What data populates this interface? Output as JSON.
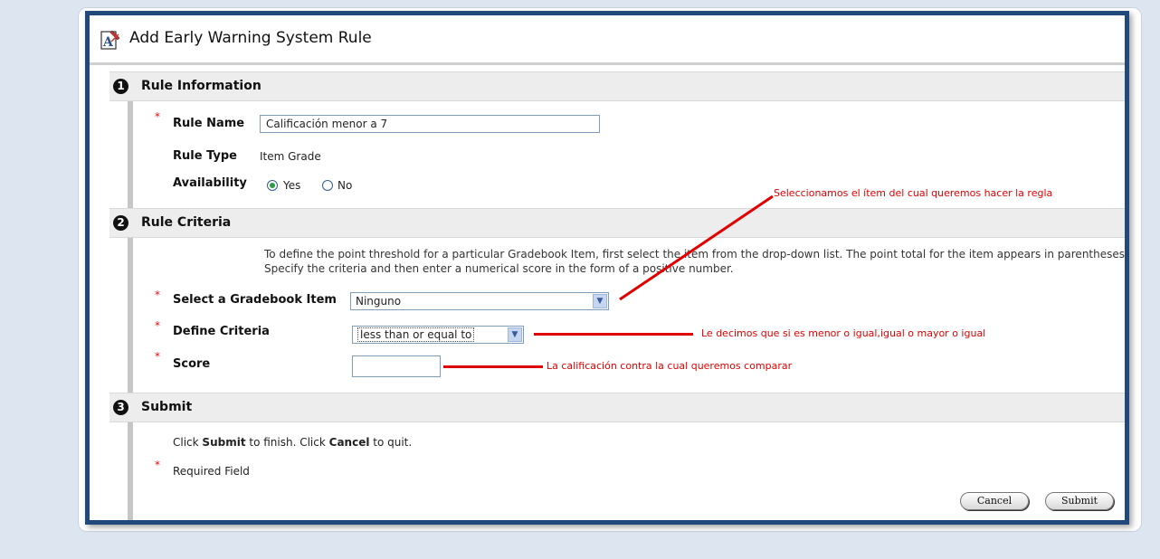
{
  "page": {
    "title": "Add Early Warning System Rule"
  },
  "sections": {
    "rule_information": {
      "number": "1",
      "title": "Rule Information",
      "rule_name_label": "Rule Name",
      "rule_name_value": "Calificación menor a 7",
      "rule_type_label": "Rule Type",
      "rule_type_value": "Item Grade",
      "availability_label": "Availability",
      "availability_yes": "Yes",
      "availability_no": "No",
      "availability_selected": "Yes"
    },
    "rule_criteria": {
      "number": "2",
      "title": "Rule Criteria",
      "description_line1": "To define the point threshold for a particular Gradebook Item, first select the item from the drop-down list. The point total for the item appears in parentheses.",
      "description_line2": "Specify the criteria and then enter a numerical score in the form of a positive number.",
      "gradebook_item_label": "Select a Gradebook Item",
      "gradebook_item_value": "Ninguno",
      "define_criteria_label": "Define Criteria",
      "define_criteria_value": "less than or equal to",
      "score_label": "Score",
      "score_value": ""
    },
    "submit": {
      "number": "3",
      "title": "Submit",
      "instr_click1": "Click ",
      "instr_submit": "Submit",
      "instr_mid": " to finish. Click ",
      "instr_cancel": "Cancel",
      "instr_end": " to quit.",
      "required_field": "Required Field",
      "cancel_button": "Cancel",
      "submit_button": "Submit"
    }
  },
  "annotations": {
    "item_note": "Seleccionamos el ítem del cual queremos hacer la regla",
    "criteria_note": "Le decimos que si es menor o igual,igual o mayor o igual",
    "score_note": "La calificación contra la cual queremos comparar"
  },
  "required_marker": "*",
  "colors": {
    "frame_border": "#22497b",
    "annotation": "#e00000",
    "required": "#dd1111",
    "section_header_bg": "#ededed"
  }
}
